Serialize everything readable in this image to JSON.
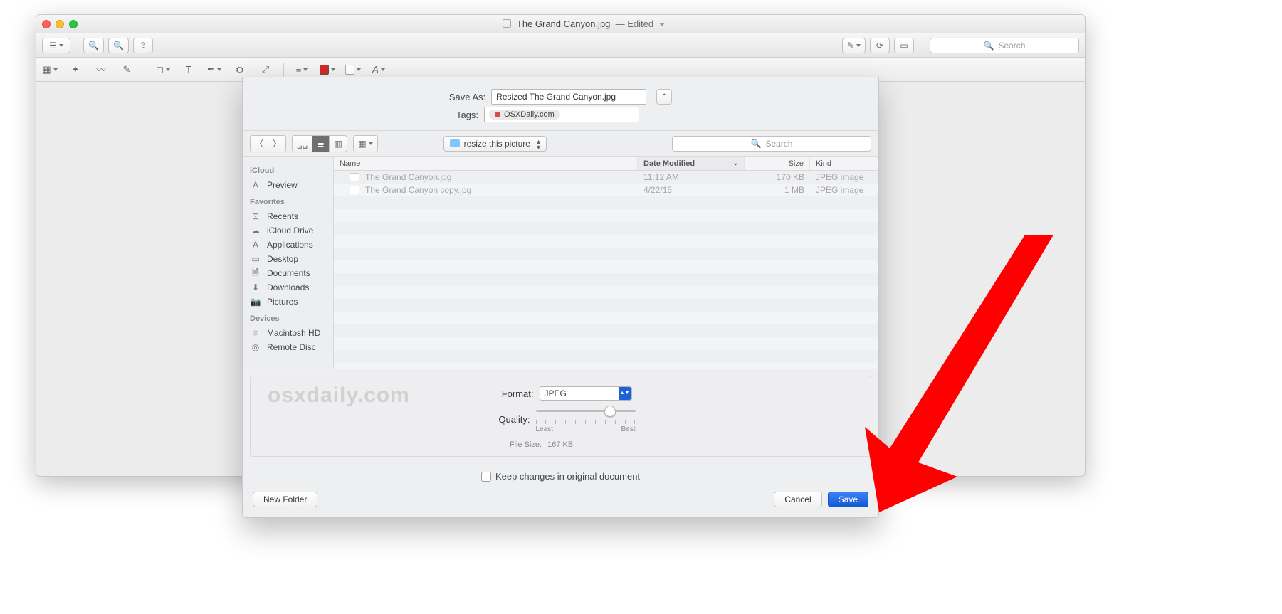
{
  "window": {
    "filename": "The Grand Canyon.jpg",
    "edited": "Edited",
    "search_placeholder": "Search"
  },
  "save_dialog": {
    "save_as_label": "Save As:",
    "save_as_value": "Resized The Grand Canyon.jpg",
    "tags_label": "Tags:",
    "tag_chip": "OSXDaily.com",
    "path_current": "resize this picture",
    "search_placeholder": "Search",
    "sidebar": {
      "groups": [
        {
          "title": "iCloud",
          "items": [
            {
              "label": "Preview",
              "icon": "A"
            }
          ]
        },
        {
          "title": "Favorites",
          "items": [
            {
              "label": "Recents",
              "icon": "⊡"
            },
            {
              "label": "iCloud Drive",
              "icon": "☁"
            },
            {
              "label": "Applications",
              "icon": "A"
            },
            {
              "label": "Desktop",
              "icon": "▭"
            },
            {
              "label": "Documents",
              "icon": "🗎"
            },
            {
              "label": "Downloads",
              "icon": "⬇"
            },
            {
              "label": "Pictures",
              "icon": "📷"
            }
          ]
        },
        {
          "title": "Devices",
          "items": [
            {
              "label": "Macintosh HD",
              "icon": "⌾"
            },
            {
              "label": "Remote Disc",
              "icon": "◎"
            }
          ]
        }
      ]
    },
    "columns": {
      "name": "Name",
      "date": "Date Modified",
      "size": "Size",
      "kind": "Kind"
    },
    "files": [
      {
        "name": "The Grand Canyon.jpg",
        "date": "11:12 AM",
        "size": "170 KB",
        "kind": "JPEG image"
      },
      {
        "name": "The Grand Canyon copy.jpg",
        "date": "4/22/15",
        "size": "1 MB",
        "kind": "JPEG image"
      }
    ],
    "options": {
      "watermark": "osxdaily.com",
      "format_label": "Format:",
      "format_value": "JPEG",
      "quality_label": "Quality:",
      "slider_least": "Least",
      "slider_best": "Best",
      "file_size_label": "File Size:",
      "file_size_value": "167 KB",
      "keep_changes": "Keep changes in original document"
    },
    "buttons": {
      "new_folder": "New Folder",
      "cancel": "Cancel",
      "save": "Save"
    }
  }
}
